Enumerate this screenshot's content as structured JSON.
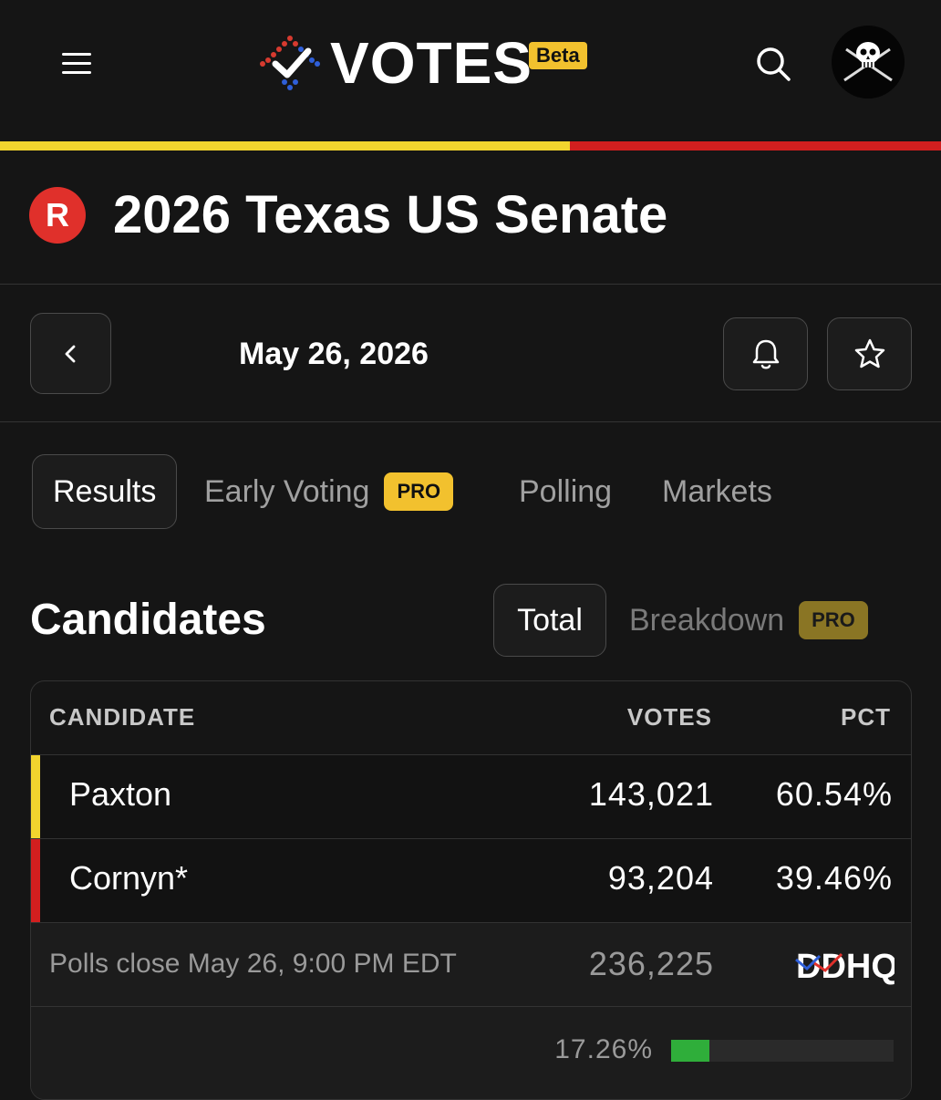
{
  "app": {
    "name": "VOTES",
    "badge": "Beta"
  },
  "header": {
    "menu_icon": "hamburger-menu-icon",
    "search_icon": "search-icon",
    "avatar_icon": "jolly-roger-avatar"
  },
  "race": {
    "party": "R",
    "title": "2026 Texas US Senate",
    "date": "May 26, 2026",
    "back_icon": "chevron-left-icon",
    "bell_icon": "bell-icon",
    "star_icon": "star-icon"
  },
  "tabs": [
    {
      "label": "Results",
      "active": true
    },
    {
      "label": "Early Voting",
      "badge": "PRO"
    },
    {
      "label": "Polling"
    },
    {
      "label": "Markets"
    }
  ],
  "candidates_section": {
    "title": "Candidates",
    "toggle_total": "Total",
    "toggle_breakdown": "Breakdown",
    "breakdown_badge": "PRO"
  },
  "table": {
    "headers": {
      "candidate": "CANDIDATE",
      "votes": "VOTES",
      "pct": "PCT"
    },
    "rows": [
      {
        "name": "Paxton",
        "votes": "143,021",
        "pct": "60.54%",
        "color": "#f2d42e"
      },
      {
        "name": "Cornyn*",
        "votes": "93,204",
        "pct": "39.46%",
        "color": "#d21f1f"
      }
    ],
    "footer": {
      "polls_close": "Polls close May 26, 9:00 PM EDT",
      "total_votes": "236,225",
      "source_logo": "DDHQ"
    },
    "reporting": {
      "pct_label": "17.26%",
      "fraction": 0.1726
    }
  },
  "colors": {
    "background": "#151515",
    "gop_red": "#e0302b",
    "paxton_yellow": "#f2d42e",
    "cornyn_red": "#d21f1f",
    "pro_gold": "#f2c12e",
    "reporting_green": "#2fae3a"
  },
  "vote_share": {
    "paxton": 0.6054,
    "cornyn": 0.3946
  }
}
